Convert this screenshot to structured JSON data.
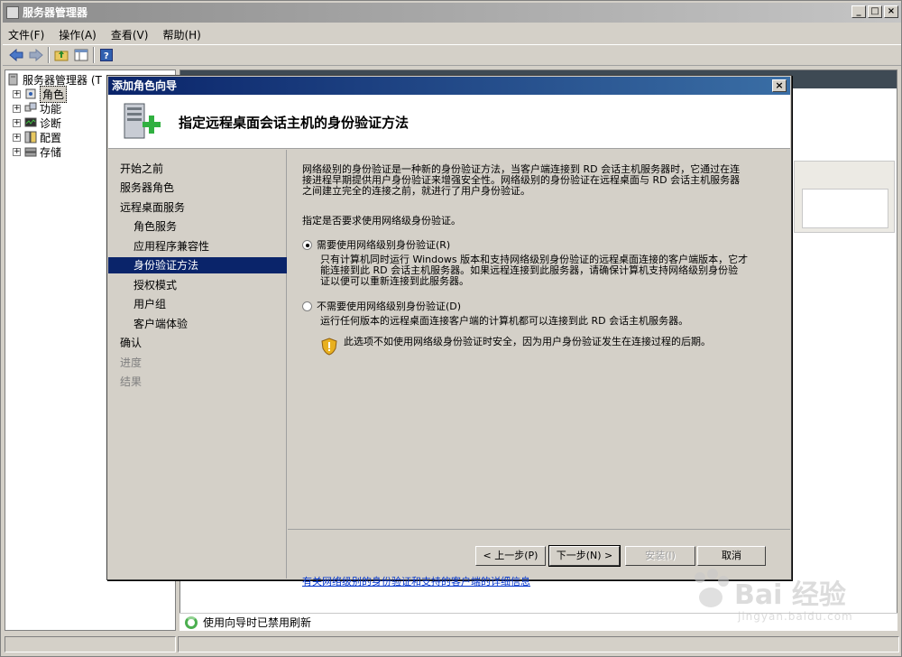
{
  "app": {
    "title": "服务器管理器",
    "menu": [
      "文件(F)",
      "操作(A)",
      "查看(V)",
      "帮助(H)"
    ],
    "window_buttons": [
      "_",
      "□",
      "×"
    ]
  },
  "tree": {
    "root": "服务器管理器 (T",
    "items": [
      {
        "label": "角色",
        "icon": "roles-icon",
        "selected": true
      },
      {
        "label": "功能",
        "icon": "features-icon"
      },
      {
        "label": "诊断",
        "icon": "diagnostics-icon"
      },
      {
        "label": "配置",
        "icon": "configuration-icon"
      },
      {
        "label": "存储",
        "icon": "storage-icon"
      }
    ]
  },
  "status_line": "使用向导时已禁用刷新",
  "wizard": {
    "title": "添加角色向导",
    "close": "×",
    "heading": "指定远程桌面会话主机的身份验证方法",
    "nav": [
      {
        "label": "开始之前",
        "level": 0,
        "state": "normal"
      },
      {
        "label": "服务器角色",
        "level": 0,
        "state": "normal"
      },
      {
        "label": "远程桌面服务",
        "level": 0,
        "state": "normal"
      },
      {
        "label": "角色服务",
        "level": 1,
        "state": "normal"
      },
      {
        "label": "应用程序兼容性",
        "level": 1,
        "state": "normal"
      },
      {
        "label": "身份验证方法",
        "level": 1,
        "state": "active"
      },
      {
        "label": "授权模式",
        "level": 1,
        "state": "normal"
      },
      {
        "label": "用户组",
        "level": 1,
        "state": "normal"
      },
      {
        "label": "客户端体验",
        "level": 1,
        "state": "normal"
      },
      {
        "label": "确认",
        "level": 0,
        "state": "normal"
      },
      {
        "label": "进度",
        "level": 0,
        "state": "disabled"
      },
      {
        "label": "结果",
        "level": 0,
        "state": "disabled"
      }
    ],
    "intro_lines": [
      "网络级别的身份验证是一种新的身份验证方法，当客户端连接到 RD 会话主机服务器时，它通过在连",
      "接进程早期提供用户身份验证来增强安全性。网络级别的身份验证在远程桌面与 RD 会话主机服务器",
      "之间建立完全的连接之前，就进行了用户身份验证。"
    ],
    "question": "指定是否要求使用网络级身份验证。",
    "option1": {
      "label": "需要使用网络级别身份验证(R)",
      "checked": true,
      "desc_lines": [
        "只有计算机同时运行 Windows 版本和支持网络级别身份验证的远程桌面连接的客户端版本，它才",
        "能连接到此 RD 会话主机服务器。如果远程连接到此服务器，请确保计算机支持网络级别身份验",
        "证以便可以重新连接到此服务器。"
      ]
    },
    "option2": {
      "label": "不需要使用网络级别身份验证(D)",
      "checked": false,
      "desc": "运行任何版本的远程桌面连接客户端的计算机都可以连接到此 RD 会话主机服务器。"
    },
    "warning": "此选项不如使用网络级身份验证时安全，因为用户身份验证发生在连接过程的后期。",
    "link": "有关网络级别的身份验证和支持的客户端的详细信息",
    "buttons": {
      "back": "< 上一步(P)",
      "next": "下一步(N) >",
      "install": "安装(I)",
      "cancel": "取消"
    }
  },
  "watermark": {
    "text": "Bai 经验",
    "sub": "jingyan.baidu.com"
  }
}
